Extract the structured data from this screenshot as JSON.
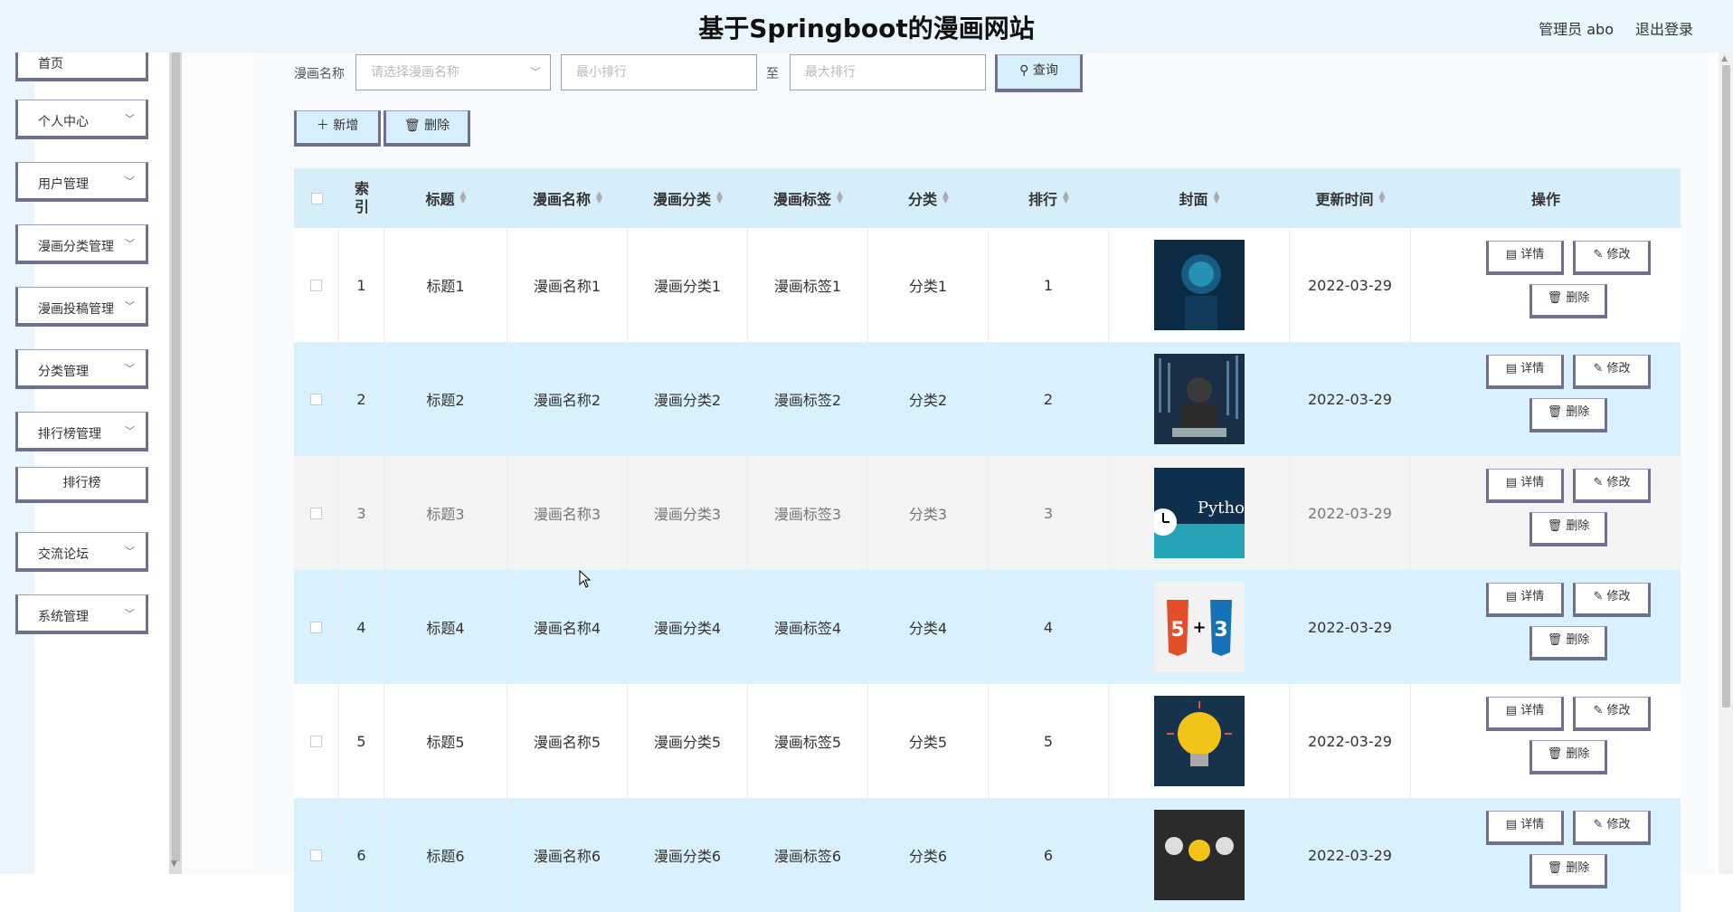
{
  "header": {
    "title": "基于Springboot的漫画网站",
    "user": "管理员 abo",
    "logout": "退出登录"
  },
  "sidebar": {
    "items": [
      {
        "label": "首页",
        "chevron": false
      },
      {
        "label": "个人中心",
        "chevron": true
      },
      {
        "label": "用户管理",
        "chevron": true
      },
      {
        "label": "漫画分类管理",
        "chevron": true
      },
      {
        "label": "漫画投稿管理",
        "chevron": true
      },
      {
        "label": "分类管理",
        "chevron": true
      },
      {
        "label": "排行榜管理",
        "chevron": true
      },
      {
        "label": "交流论坛",
        "chevron": true
      },
      {
        "label": "系统管理",
        "chevron": true
      }
    ],
    "subitem": "排行榜"
  },
  "search": {
    "name_label": "漫画名称",
    "name_placeholder": "请选择漫画名称",
    "min_placeholder": "最小排行",
    "to_label": "至",
    "max_placeholder": "最大排行",
    "query_button": "查询"
  },
  "toolbar": {
    "add_button": "新增",
    "delete_button": "删除"
  },
  "table": {
    "headers": [
      "索引",
      "标题",
      "漫画名称",
      "漫画分类",
      "漫画标签",
      "分类",
      "排行",
      "封面",
      "更新时间",
      "操作"
    ],
    "rows": [
      {
        "index": "1",
        "title": "标题1",
        "name": "漫画名称1",
        "category": "漫画分类1",
        "tag": "漫画标签1",
        "cls": "分类1",
        "rank": "1",
        "date": "2022-03-29"
      },
      {
        "index": "2",
        "title": "标题2",
        "name": "漫画名称2",
        "category": "漫画分类2",
        "tag": "漫画标签2",
        "cls": "分类2",
        "rank": "2",
        "date": "2022-03-29"
      },
      {
        "index": "3",
        "title": "标题3",
        "name": "漫画名称3",
        "category": "漫画分类3",
        "tag": "漫画标签3",
        "cls": "分类3",
        "rank": "3",
        "date": "2022-03-29"
      },
      {
        "index": "4",
        "title": "标题4",
        "name": "漫画名称4",
        "category": "漫画分类4",
        "tag": "漫画标签4",
        "cls": "分类4",
        "rank": "4",
        "date": "2022-03-29"
      },
      {
        "index": "5",
        "title": "标题5",
        "name": "漫画名称5",
        "category": "漫画分类5",
        "tag": "漫画标签5",
        "cls": "分类5",
        "rank": "5",
        "date": "2022-03-29"
      },
      {
        "index": "6",
        "title": "标题6",
        "name": "漫画名称6",
        "category": "漫画分类6",
        "tag": "漫画标签6",
        "cls": "分类6",
        "rank": "6",
        "date": "2022-03-29"
      }
    ],
    "actions": {
      "detail": "详情",
      "edit": "修改",
      "delete": "删除"
    },
    "cover_text": {
      "python": "Python"
    }
  },
  "colors": {
    "header_bg": "#e9f6fd",
    "row_alt": "#d9f1fd",
    "accent_border": "#6f6f8e"
  }
}
